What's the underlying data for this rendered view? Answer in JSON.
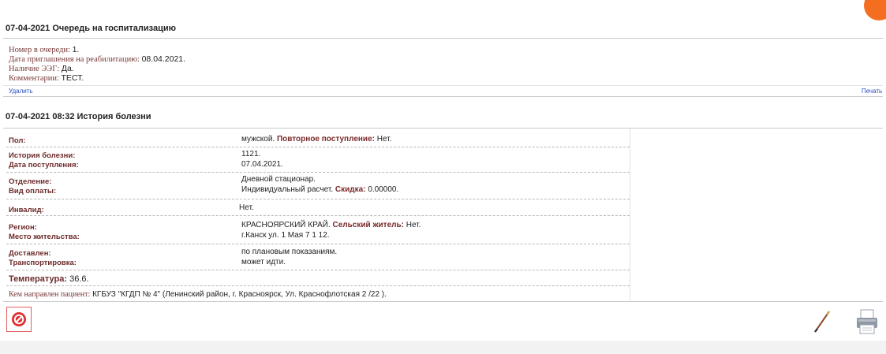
{
  "queue": {
    "title": "07-04-2021 Очередь на госпитализацию",
    "rows": [
      {
        "label": "Номер в очереди:",
        "value": "1."
      },
      {
        "label": "Дата приглашения на реабилитацию:",
        "value": "08.04.2021."
      },
      {
        "label": "Наличие ЭЭГ:",
        "value": "Да."
      },
      {
        "label": "Комментарии:",
        "value": "ТЕСТ."
      }
    ],
    "delete_link": "Удалить",
    "print_link": "Печать"
  },
  "history": {
    "title": "07-04-2021 08:32 История болезни",
    "sex_label": "Пол:",
    "sex_value": "мужской.",
    "readmission_label": "Повторное поступление:",
    "readmission_value": "Нет.",
    "case_label": "История болезни:",
    "case_value": "1121.",
    "admission_label": "Дата поступления:",
    "admission_value": "07.04.2021.",
    "department_label": "Отделение:",
    "department_value": "Дневной стационар.",
    "payment_label": "Вид оплаты:",
    "payment_value": "Индивидуальный расчет.",
    "discount_label": "Скидка:",
    "discount_value": "0.00000.",
    "disabled_label": "Инвалид:",
    "disabled_value": "Нет.",
    "region_label": "Регион:",
    "region_value": "КРАСНОЯРСКИЙ КРАЙ.",
    "rural_label": "Сельский житель:",
    "rural_value": "Нет.",
    "residence_label": "Место жительства:",
    "residence_value": "г.Канск ул. 1 Мая 7 1 12.",
    "delivered_label": "Доставлен:",
    "delivered_value": "по плановым показаниям.",
    "transport_label": "Транспортировка:",
    "transport_value": "может идти.",
    "temperature_label": "Температура:",
    "temperature_value": "36.6.",
    "referral_label": "Кем направлен пациент:",
    "referral_value": "КГБУЗ \"КГДП № 4\" (Ленинский район, г. Красноярск, Ул. Краснофлотская 2 /22 )."
  },
  "icons": {
    "cancel": "cancel-icon",
    "edit": "pen-icon",
    "print": "printer-icon"
  },
  "colors": {
    "label": "#6d2a2a",
    "link": "#2a4fbf",
    "badge": "#f36f1f",
    "cancel": "#e03030"
  }
}
